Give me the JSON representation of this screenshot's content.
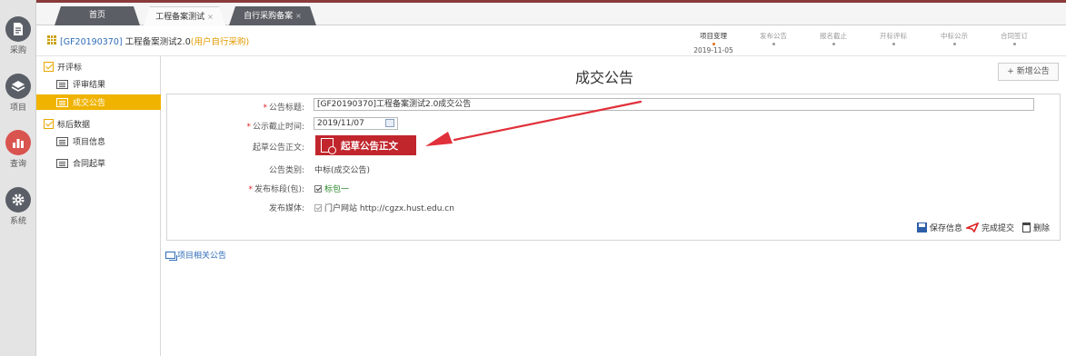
{
  "sidebar": {
    "items": [
      {
        "label": "采购",
        "icon": "document-icon"
      },
      {
        "label": "项目",
        "icon": "layers-icon"
      },
      {
        "label": "查询",
        "icon": "bar-chart-icon"
      },
      {
        "label": "系统",
        "icon": "gear-icon"
      }
    ]
  },
  "tabs": [
    {
      "label": "首页",
      "close": ""
    },
    {
      "label": "工程备案测试",
      "close": "×"
    },
    {
      "label": "自行采购备案",
      "close": "×"
    }
  ],
  "header": {
    "code": "[GF20190370]",
    "name": "工程备案测试2.0",
    "note": "(用户自行采购)"
  },
  "steps": [
    {
      "label": "项目变理",
      "date": "2019-11-05"
    },
    {
      "label": "发布公告",
      "date": ""
    },
    {
      "label": "报名截止",
      "date": ""
    },
    {
      "label": "开标评标",
      "date": ""
    },
    {
      "label": "中标公示",
      "date": ""
    },
    {
      "label": "合同签订",
      "date": ""
    }
  ],
  "nav": {
    "groups": [
      {
        "label": "开评标",
        "items": [
          "评审结果",
          "成交公告"
        ]
      },
      {
        "label": "标后数据",
        "items": [
          "项目信息",
          "合同起草"
        ]
      }
    ],
    "selected": "成交公告"
  },
  "main": {
    "title": "成交公告",
    "add_button": "+ 新增公告"
  },
  "form": {
    "required_mark": "*",
    "title_label": "公告标题:",
    "title_value": "[GF20190370]工程备案测试2.0成交公告",
    "deadline_label": "公示截止时间:",
    "deadline_value": "2019/11/07",
    "draft_label": "起草公告正文:",
    "draft_button": "起草公告正文",
    "category_label": "公告类别:",
    "category_value": "中标(成交公告)",
    "section_label": "发布标段(包):",
    "section_value": "标包一",
    "media_label": "发布媒体:",
    "media_value": "门户网站 http://cgzx.hust.edu.cn"
  },
  "actions": {
    "save": "保存信息",
    "submit": "完成提交",
    "delete": "删除"
  },
  "related": "项目相关公告",
  "colors": {
    "accent": "#f0b300",
    "draft_button": "#c1262c",
    "arrow": "#e0303a",
    "link": "#2f6db8"
  }
}
